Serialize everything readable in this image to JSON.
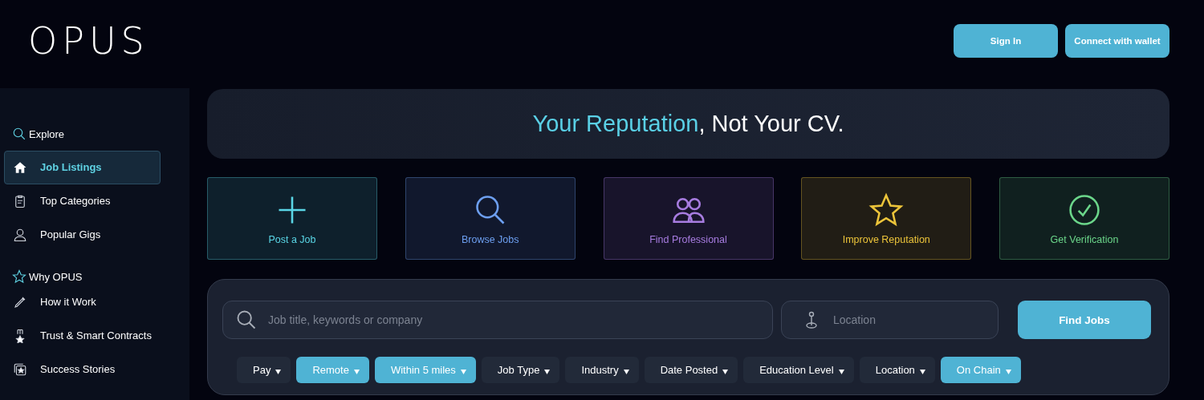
{
  "header": {
    "logo": "OPUS",
    "buttons": [
      "Sign In",
      "Connect with wallet"
    ]
  },
  "sidebar": {
    "sections": [
      {
        "title": "Explore",
        "kind": "search",
        "items": [
          {
            "label": "Job Listings",
            "kind": "home",
            "selected": true
          },
          {
            "label": "Top Categories",
            "kind": "clipboard",
            "selected": false
          },
          {
            "label": "Popular Gigs",
            "kind": "person",
            "selected": false
          }
        ]
      },
      {
        "title": "Why OPUS",
        "kind": "star",
        "items": [
          {
            "label": "How it Work",
            "kind": "pen",
            "selected": false
          },
          {
            "label": "Trust & Smart Contracts",
            "kind": "medal",
            "selected": false
          },
          {
            "label": "Success Stories",
            "kind": "framed",
            "selected": false
          }
        ]
      }
    ]
  },
  "hero": {
    "highlight": "Your Reputation",
    "rest": ", Not Your CV."
  },
  "actions": [
    {
      "label": "Post a Job",
      "kind": "plus",
      "color": "#5ad6e6"
    },
    {
      "label": "Browse Jobs",
      "kind": "search",
      "color": "#6d9ff0"
    },
    {
      "label": "Find Professional",
      "kind": "people",
      "color": "#a77ce0"
    },
    {
      "label": "Improve Reputation",
      "kind": "star",
      "color": "#ecc43a"
    },
    {
      "label": "Get Verification",
      "kind": "check",
      "color": "#6bd68a"
    }
  ],
  "search": {
    "keyword_placeholder": "Job title, keywords or company",
    "location_placeholder": "Location",
    "button": "Find Jobs"
  },
  "filters": [
    {
      "label": "Pay",
      "selected": false
    },
    {
      "label": "Remote",
      "selected": true
    },
    {
      "label": "Within 5 miles",
      "selected": true
    },
    {
      "label": "Job Type",
      "selected": false
    },
    {
      "label": "Industry",
      "selected": false
    },
    {
      "label": "Date Posted",
      "selected": false
    },
    {
      "label": "Education Level",
      "selected": false
    },
    {
      "label": "Location",
      "selected": false
    },
    {
      "label": "On Chain",
      "selected": true
    }
  ]
}
